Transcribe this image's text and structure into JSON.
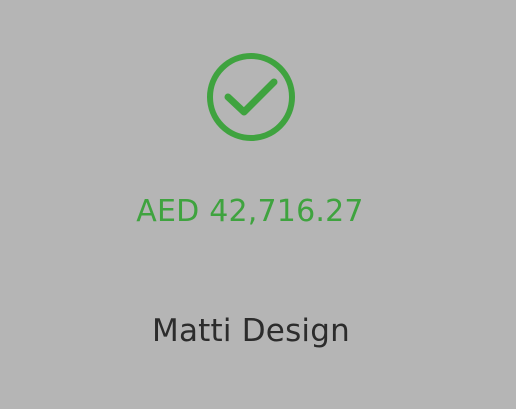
{
  "status": {
    "icon": "check-circle-icon",
    "accent_color": "#3fa33f"
  },
  "payment": {
    "amount": "AED 42,716.27"
  },
  "recipient": {
    "name": "Matti Design"
  }
}
